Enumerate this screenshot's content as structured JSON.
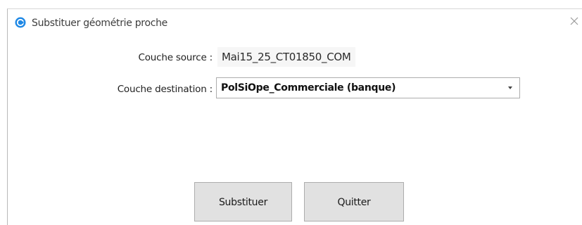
{
  "window": {
    "title": "Substituer géométrie proche",
    "app_icon": "blue-circle-logo-icon",
    "close_icon": "close-icon"
  },
  "form": {
    "source_label": "Couche source :",
    "source_value": "Mai15_25_CT01850_COM",
    "destination_label": "Couche destination :",
    "destination_value": "PolSiOpe_Commerciale (banque)",
    "dropdown_icon": "chevron-down-icon"
  },
  "buttons": {
    "substitute_label": "Substituer",
    "quit_label": "Quitter"
  },
  "colors": {
    "accent": "#1e88e5",
    "button_bg": "#e1e1e1",
    "button_border": "#adadad"
  }
}
